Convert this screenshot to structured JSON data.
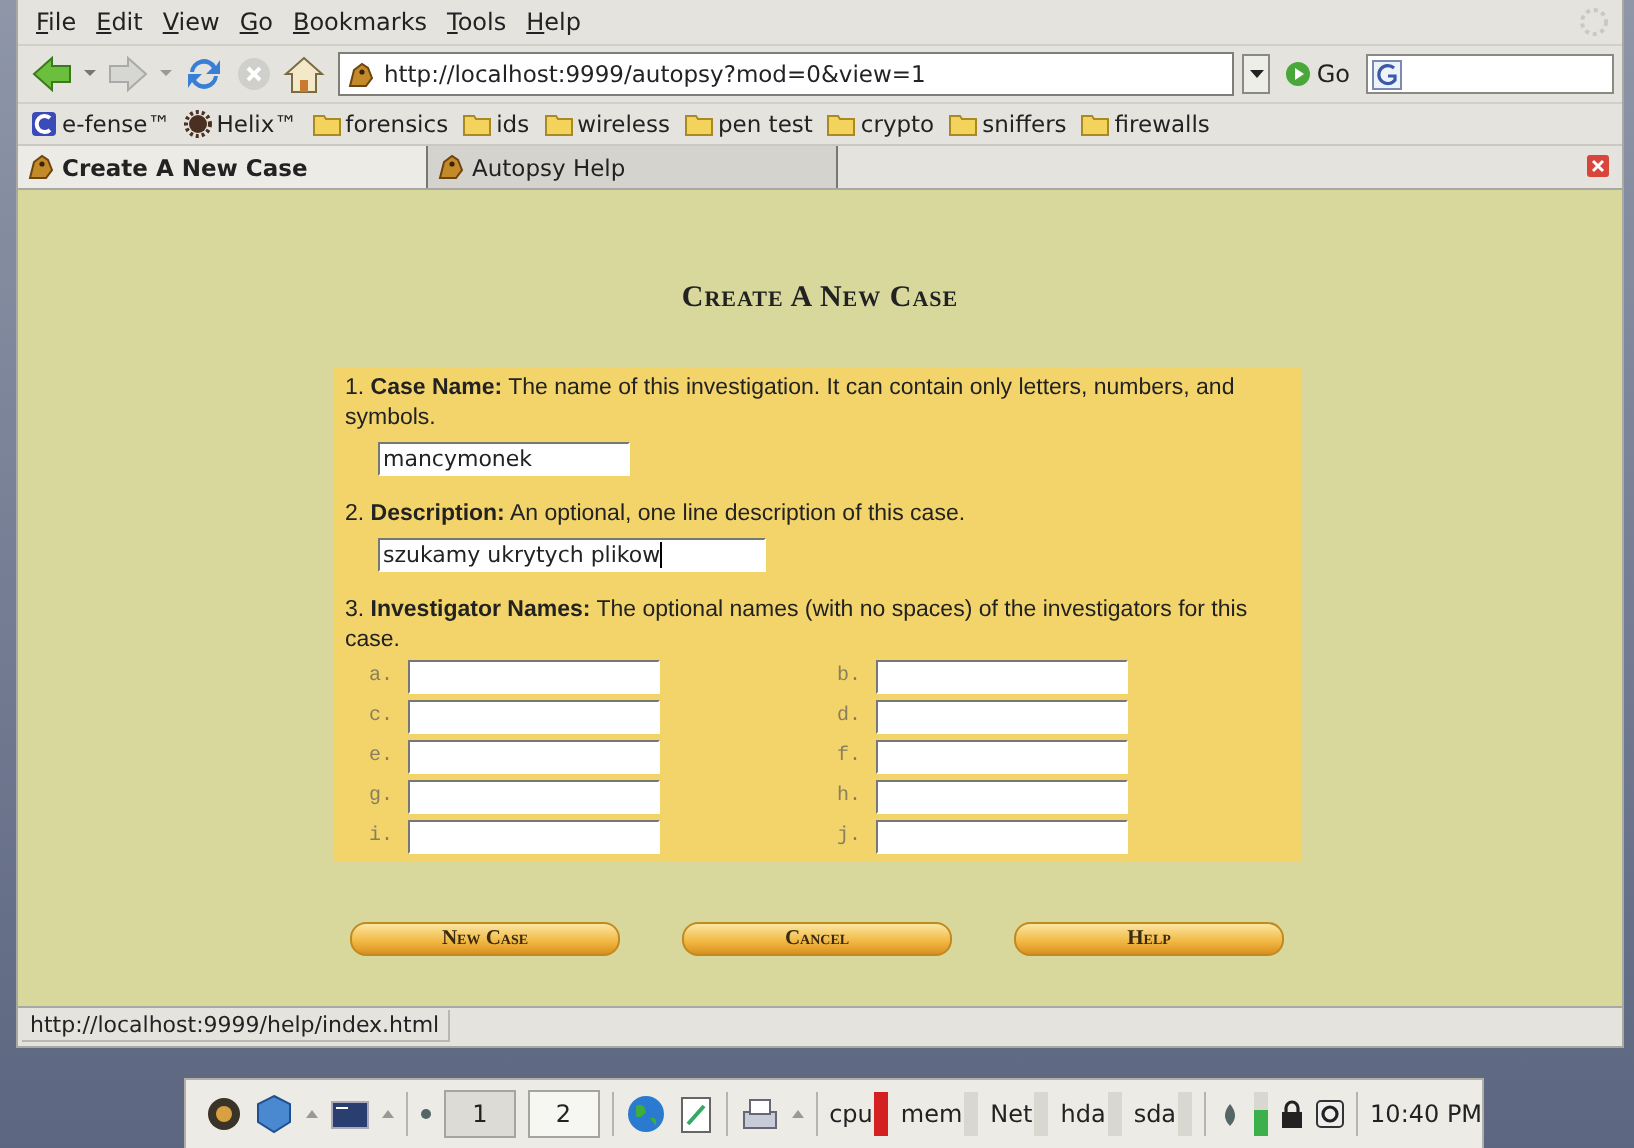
{
  "menu": [
    "File",
    "Edit",
    "View",
    "Go",
    "Bookmarks",
    "Tools",
    "Help"
  ],
  "address": {
    "value": "http://localhost:9999/autopsy?mod=0&view=1"
  },
  "go_button": "Go",
  "bookmarks": [
    {
      "label": "e-fense™",
      "kind": "site"
    },
    {
      "label": "Helix™",
      "kind": "gear"
    },
    {
      "label": "forensics",
      "kind": "folder"
    },
    {
      "label": "ids",
      "kind": "folder"
    },
    {
      "label": "wireless",
      "kind": "folder"
    },
    {
      "label": "pen test",
      "kind": "folder"
    },
    {
      "label": "crypto",
      "kind": "folder"
    },
    {
      "label": "sniffers",
      "kind": "folder"
    },
    {
      "label": "firewalls",
      "kind": "folder"
    }
  ],
  "tabs": [
    {
      "label": "Create A New Case",
      "selected": true
    },
    {
      "label": "Autopsy Help",
      "selected": false
    }
  ],
  "page": {
    "title": "Create A New Case",
    "sections": [
      {
        "number": "1.",
        "heading": "Case Name:",
        "text": "The name of this investigation. It can contain only letters, numbers, and symbols.",
        "fields": [
          {
            "value": "mancymonek",
            "focused": false
          }
        ]
      },
      {
        "number": "2.",
        "heading": "Description:",
        "text": "An optional, one line description of this case.",
        "fields": [
          {
            "value": "szukamy ukrytych plikow",
            "focused": true
          }
        ]
      },
      {
        "number": "3.",
        "heading": "Investigator Names:",
        "text": "The optional names (with no spaces) of the investigators for this case.",
        "investigators": [
          "a.",
          "b.",
          "c.",
          "d.",
          "e.",
          "f.",
          "g.",
          "h.",
          "i.",
          "j."
        ]
      }
    ],
    "buttons": [
      "New Case",
      "Cancel",
      "Help"
    ]
  },
  "status_bar": "http://localhost:9999/help/index.html",
  "taskbar": {
    "workspaces": [
      {
        "label": "1",
        "selected": true
      },
      {
        "label": "2",
        "selected": false
      }
    ],
    "monitors": [
      {
        "label": "cpu",
        "color": "#d42020"
      },
      {
        "label": "mem",
        "color": "#d8d8d0"
      },
      {
        "label": "Net",
        "color": "#d8d8d0"
      },
      {
        "label": "hda",
        "color": "#d8d8d0"
      },
      {
        "label": "sda",
        "color": "#d8d8d0"
      }
    ],
    "clock": "10:40 PM"
  }
}
